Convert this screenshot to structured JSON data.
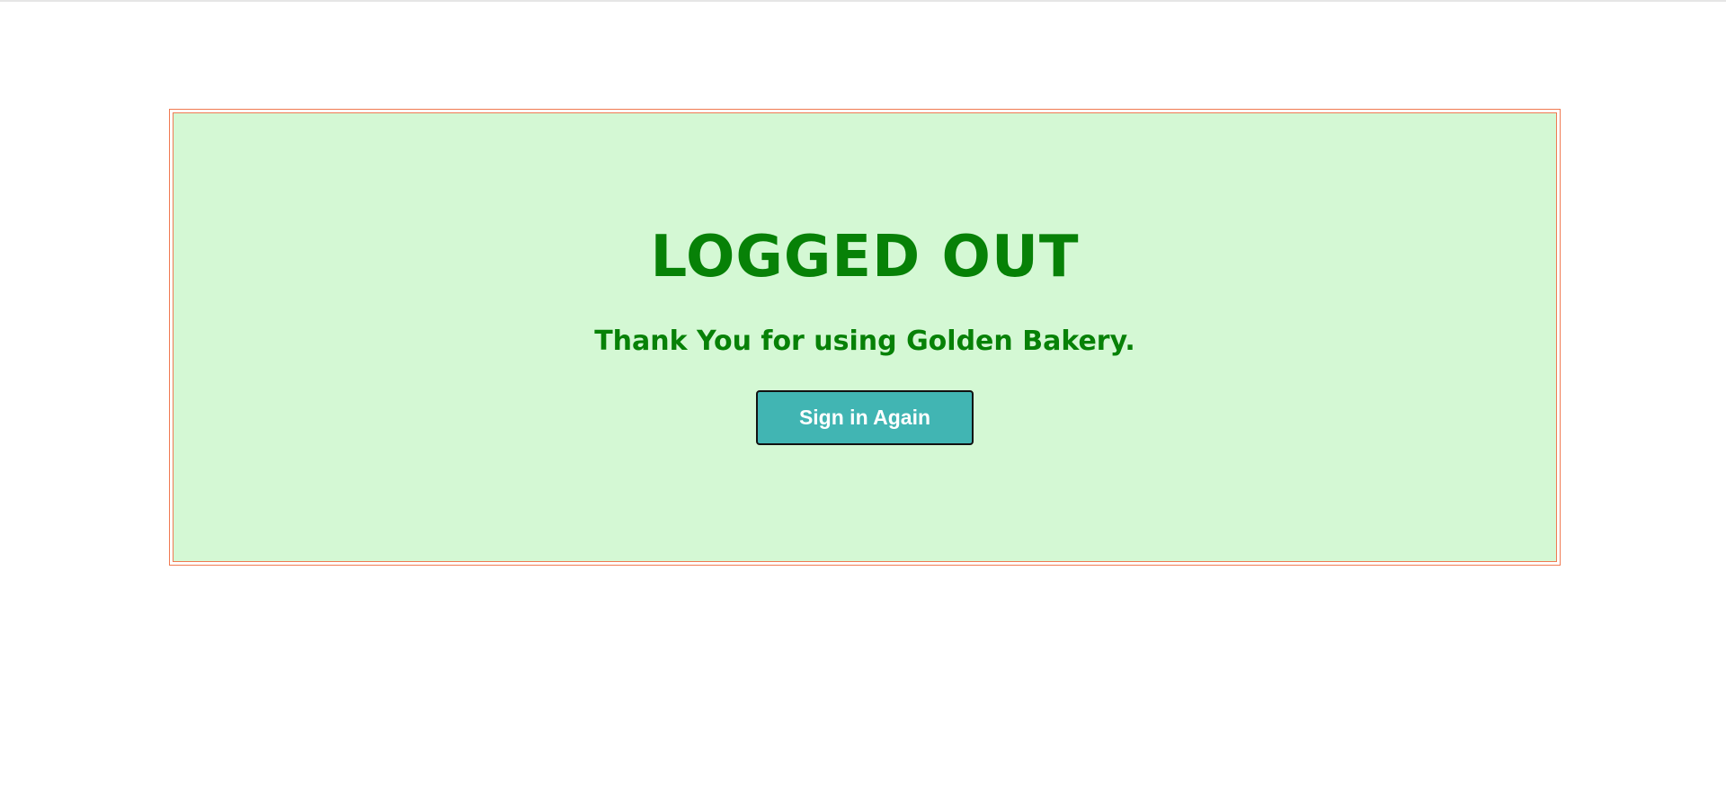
{
  "logout_panel": {
    "title": "LOGGED OUT",
    "message": "Thank You for using Golden Bakery.",
    "button_label": "Sign in Again"
  },
  "colors": {
    "panel_background": "#d4f8d4",
    "panel_border": "#f07a52",
    "text": "#078107",
    "button_background": "#41b5b3",
    "button_text": "#ffffff"
  }
}
